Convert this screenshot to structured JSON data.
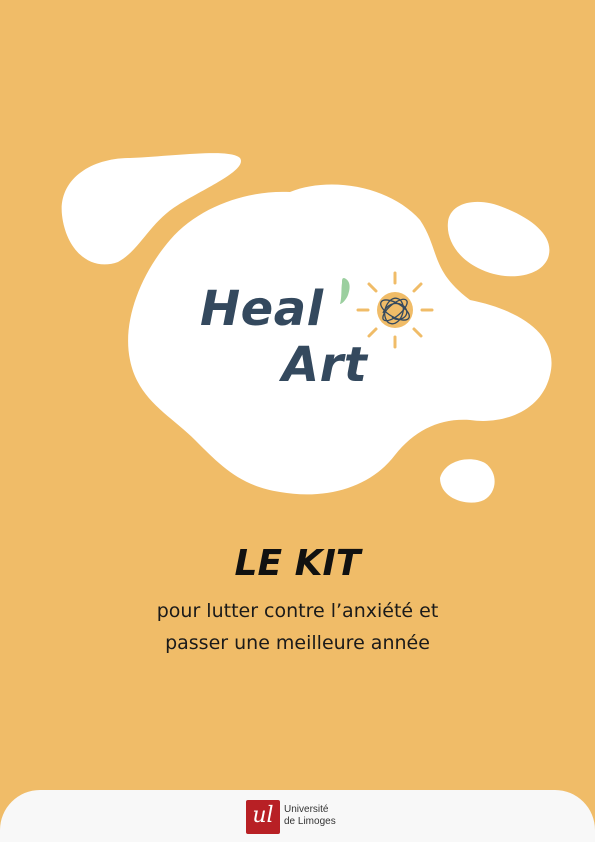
{
  "logo": {
    "line1": "Heal",
    "line2": "Art",
    "colors": {
      "text": "#34495e",
      "sun": "#f0bc68",
      "apostrophe": "#9bcf9f"
    },
    "icon": "sun-icon"
  },
  "title": "LE KIT",
  "subtitle": {
    "line1": "pour lutter contre l’anxiété et",
    "line2": "passer une meilleure année"
  },
  "footer": {
    "logo_mark": "ul",
    "name_line1": "Université",
    "name_line2": "de Limoges",
    "colors": {
      "mark": "#b82025"
    }
  },
  "colors": {
    "background": "#f0bc68",
    "blob": "#ffffff",
    "footer": "#f8f8f8"
  }
}
